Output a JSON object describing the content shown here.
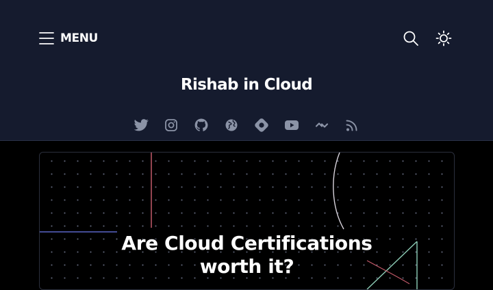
{
  "header": {
    "menu_label": "MENU",
    "site_title": "Rishab in Cloud",
    "icons": {
      "menu": "hamburger-icon",
      "search": "search-icon",
      "theme": "sun-icon"
    },
    "socials": [
      {
        "name": "twitter-icon"
      },
      {
        "name": "instagram-icon"
      },
      {
        "name": "github-icon"
      },
      {
        "name": "globe-icon"
      },
      {
        "name": "hashnode-icon"
      },
      {
        "name": "youtube-icon"
      },
      {
        "name": "dev-link-icon"
      },
      {
        "name": "rss-icon"
      }
    ]
  },
  "featured_post": {
    "title_line1": "Are Cloud Certifications",
    "title_line2": "worth it?"
  },
  "colors": {
    "header_bg": "#151b2e",
    "page_bg": "#000000",
    "icon_gray": "#8b93a6",
    "text": "#ffffff"
  }
}
